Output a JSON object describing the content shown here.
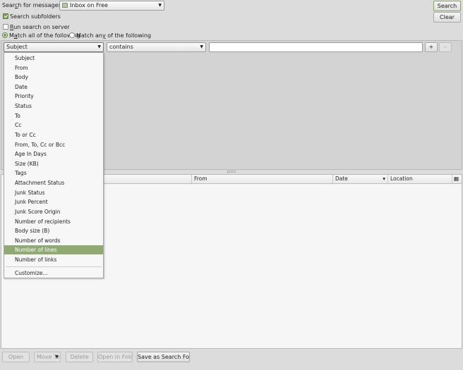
{
  "search": {
    "label_prefix": "Sear",
    "label_accel": "c",
    "label_suffix": "h for messages in:",
    "folder": "Inbox on Free",
    "search_button": "Search",
    "clear_button": "Clear"
  },
  "options": {
    "search_subfolders": "Search subfolders",
    "search_subfolders_checked": true,
    "run_on_server_accel": "R",
    "run_on_server_rest": "un search on server",
    "run_on_server_checked": false,
    "match_all_prefix": "M",
    "match_all_accel": "a",
    "match_all_rest": "tch all of the following",
    "match_any_prefix": "Match an",
    "match_any_accel": "y",
    "match_any_rest": " of the following",
    "match_all_selected": true
  },
  "rule": {
    "field": "Subject",
    "operator": "contains",
    "value": "",
    "add_label": "+",
    "remove_label": "–"
  },
  "menu": {
    "items": [
      "Subject",
      "From",
      "Body",
      "Date",
      "Priority",
      "Status",
      "To",
      "Cc",
      "To or Cc",
      "From, To, Cc or Bcc",
      "Age In Days",
      "Size (KB)",
      "Tags",
      "Attachment Status",
      "Junk Status",
      "Junk Percent",
      "Junk Score Origin",
      "Number of recipients",
      "Body size (B)",
      "Number of words",
      "Number of lines",
      "Number of links"
    ],
    "selected_index": 20,
    "customize": "Customize..."
  },
  "results": {
    "columns": [
      "From",
      "Date",
      "Location"
    ],
    "sort_indicator": "▾"
  },
  "actions": {
    "open": "Open",
    "move_to": "Move To",
    "delete": "Delete",
    "open_in_folder": "Open in Folder",
    "save_as_search_folder": "Save as Search Folder"
  },
  "colors": {
    "selection": "#91aa73",
    "checkbox_accent": "#7ea05a"
  }
}
